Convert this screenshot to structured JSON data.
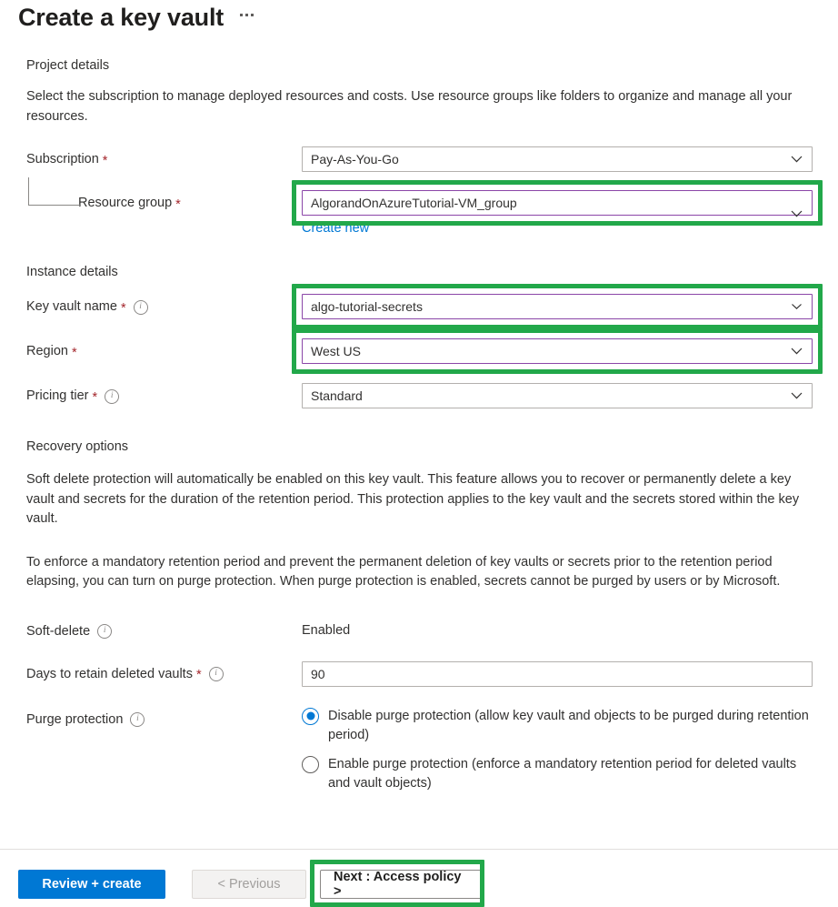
{
  "header": {
    "title": "Create a key vault",
    "more_menu": "…"
  },
  "project_details": {
    "section_label": "Project details",
    "description": "Select the subscription to manage deployed resources and costs. Use resource groups like folders to organize and manage all your resources.",
    "subscription": {
      "label": "Subscription",
      "required": "*",
      "value": "Pay-As-You-Go",
      "icon": "chevron-down-icon"
    },
    "resource_group": {
      "label": "Resource group",
      "required": "*",
      "value": "AlgorandOnAzureTutorial-VM_group",
      "icon": "chevron-down-icon",
      "create_new_link": "Create new",
      "highlighted": true
    }
  },
  "instance_details": {
    "section_label": "Instance details",
    "key_vault_name": {
      "label": "Key vault name",
      "required": "*",
      "info": "i",
      "value": "algo-tutorial-secrets",
      "icon": "chevron-down-icon",
      "highlighted": true
    },
    "region": {
      "label": "Region",
      "required": "*",
      "value": "West US",
      "icon": "chevron-down-icon",
      "highlighted": true
    },
    "pricing_tier": {
      "label": "Pricing tier",
      "required": "*",
      "info": "i",
      "value": "Standard",
      "icon": "chevron-down-icon",
      "highlighted": false
    }
  },
  "recovery_options": {
    "section_label": "Recovery options",
    "paragraph_1": "Soft delete protection will automatically be enabled on this key vault. This feature allows you to recover or permanently delete a key vault and secrets for the duration of the retention period. This protection applies to the key vault and the secrets stored within the key vault.",
    "paragraph_2": "To enforce a mandatory retention period and prevent the permanent deletion of key vaults or secrets prior to the retention period elapsing, you can turn on purge protection. When purge protection is enabled, secrets cannot be purged by users or by Microsoft.",
    "soft_delete": {
      "label": "Soft-delete",
      "info": "i",
      "value": "Enabled"
    },
    "days_to_retain": {
      "label": "Days to retain deleted vaults",
      "required": "*",
      "info": "i",
      "value": "90"
    },
    "purge_protection": {
      "label": "Purge protection",
      "info": "i",
      "options": [
        {
          "label": "Disable purge protection (allow key vault and objects to be purged during retention period)",
          "checked": true
        },
        {
          "label": "Enable purge protection (enforce a mandatory retention period for deleted vaults and vault objects)",
          "checked": false
        }
      ]
    }
  },
  "footer": {
    "review_create": "Review + create",
    "previous": "< Previous",
    "next": "Next : Access policy >",
    "next_highlighted": true
  },
  "colors": {
    "accent_blue": "#0078d4",
    "highlight_green": "#22a84a",
    "field_focus_purple": "#8b46a8",
    "required_red": "#a4262c"
  }
}
